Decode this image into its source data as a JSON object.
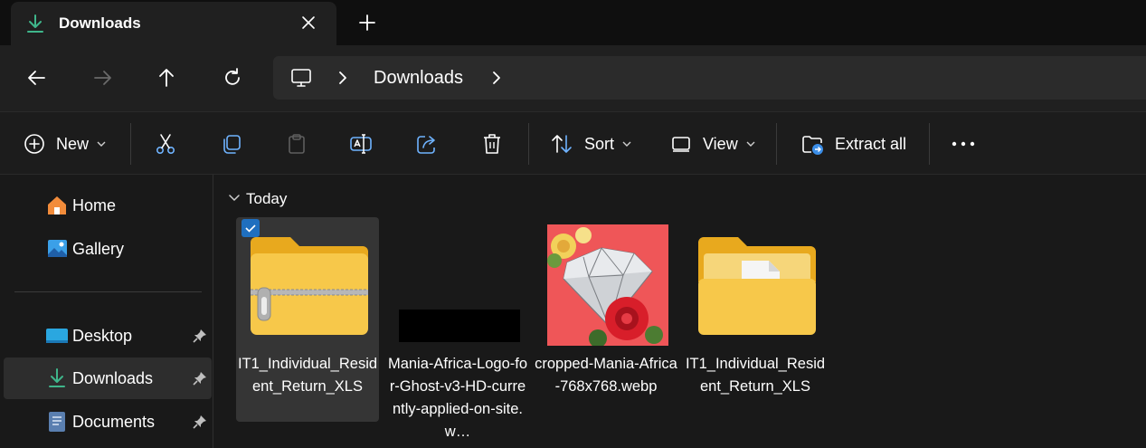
{
  "tab": {
    "title": "Downloads"
  },
  "address": {
    "segments": [
      "Downloads"
    ]
  },
  "commands": {
    "new_label": "New",
    "sort_label": "Sort",
    "view_label": "View",
    "extract_label": "Extract all"
  },
  "sidebar": {
    "items": [
      {
        "label": "Home"
      },
      {
        "label": "Gallery"
      },
      {
        "label": "Desktop"
      },
      {
        "label": "Downloads"
      },
      {
        "label": "Documents"
      }
    ]
  },
  "content": {
    "group_title": "Today",
    "items": [
      {
        "name": "IT1_Individual_Resident_Return_XLS",
        "kind": "zip-folder",
        "selected": true
      },
      {
        "name": "Mania-Africa-Logo-for-Ghost-v3-HD-currently-applied-on-site.w…",
        "kind": "image-black"
      },
      {
        "name": "cropped-Mania-Africa-768x768.webp",
        "kind": "image-diamond"
      },
      {
        "name": "IT1_Individual_Resident_Return_XLS",
        "kind": "folder"
      }
    ]
  },
  "colors": {
    "accent": "#1f6fbf",
    "folder": "#f4c542",
    "download_green": "#3fb68b"
  }
}
